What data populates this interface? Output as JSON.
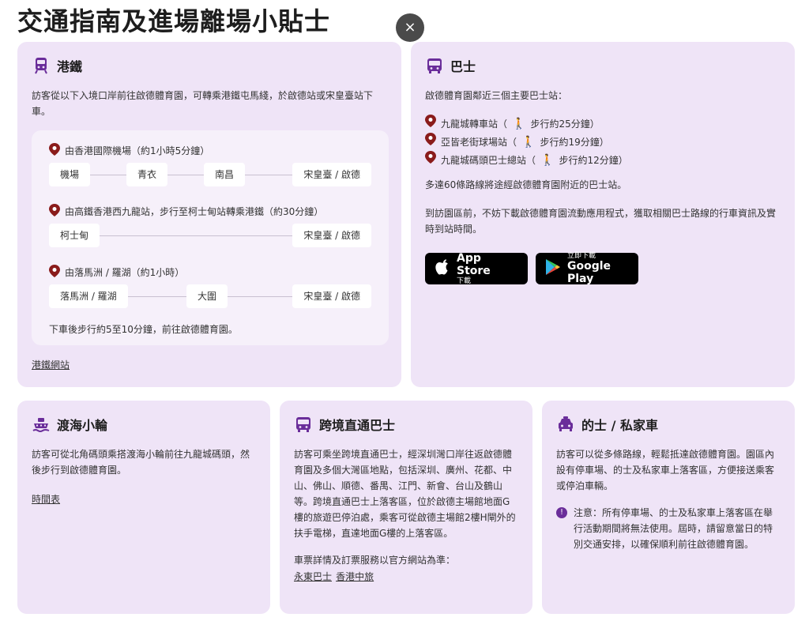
{
  "page": {
    "title": "交通指南及進場離場小貼士",
    "close": "×"
  },
  "mtr": {
    "title": "港鐵",
    "desc": "訪客從以下入境口岸前往啟德體育園，可轉乘港鐵屯馬綫，於啟德站或宋皇臺站下車。",
    "routes": [
      {
        "title": "由香港國際機場（約1小時5分鐘）",
        "stops": [
          "機場",
          "青衣",
          "南昌",
          "宋皇臺 / 啟德"
        ]
      },
      {
        "title": "由高鐵香港西九龍站，步行至柯士甸站轉乘港鐵（約30分鐘）",
        "stops": [
          "柯士甸",
          "宋皇臺 / 啟德"
        ]
      },
      {
        "title": "由落馬洲 / 羅湖（約1小時）",
        "stops": [
          "落馬洲 / 羅湖",
          "大圍",
          "宋皇臺 / 啟德"
        ]
      }
    ],
    "walk_note": "下車後步行約5至10分鐘，前往啟德體育園。",
    "link": "港鐵網站"
  },
  "bus": {
    "title": "巴士",
    "intro": "啟德體育園鄰近三個主要巴士站：",
    "stations": [
      {
        "name": "九龍城轉車站（",
        "walk": "步行約25分鐘）"
      },
      {
        "name": "亞皆老街球場站（",
        "walk": "步行約19分鐘）"
      },
      {
        "name": "九龍城碼頭巴士總站（",
        "walk": "步行約12分鐘）"
      }
    ],
    "routes_note": "多達60條路線將途經啟德體育園附近的巴士站。",
    "app_note": "到訪園區前，不妨下載啟德體育園流動應用程式，獲取相關巴士路線的行車資訊及實時到站時間。",
    "appstore": {
      "small": "下載",
      "big": "App Store"
    },
    "googleplay": {
      "small": "立即下載",
      "big": "Google Play"
    }
  },
  "ferry": {
    "title": "渡海小輪",
    "desc": "訪客可從北角碼頭乘搭渡海小輪前往九龍城碼頭，然後步行到啟德體育園。",
    "link": "時間表"
  },
  "cross": {
    "title": "跨境直通巴士",
    "desc": "訪客可乘坐跨境直通巴士，經深圳灣口岸往返啟德體育園及多個大灣區地點，包括深圳、廣州、花都、中山、佛山、順德、番禺、江門、新會、台山及鶴山等。跨境直通巴士上落客區，位於啟德主場館地面G樓的旅遊巴停泊處，乘客可從啟德主場館2樓H閘外的扶手電梯，直達地面G樓的上落客區。",
    "ticket_note": "車票詳情及訂票服務以官方網站為準：",
    "link1": "永東巴士",
    "link2": "香港中旅"
  },
  "taxi": {
    "title": "的士 / 私家車",
    "desc": "訪客可以從多條路線，輕鬆抵達啟德體育園。園區內設有停車場、的士及私家車上落客區，方便接送乘客或停泊車輛。",
    "note_mark": "!",
    "note": "注意：所有停車場、的士及私家車上落客區在舉行活動期間將無法使用。屆時，請留意當日的特別交通安排，以確保順利前往啟德體育園。"
  },
  "colors": {
    "card": "#efe4f7",
    "accent": "#6a2d9a",
    "pin": "#8a1b1b"
  }
}
